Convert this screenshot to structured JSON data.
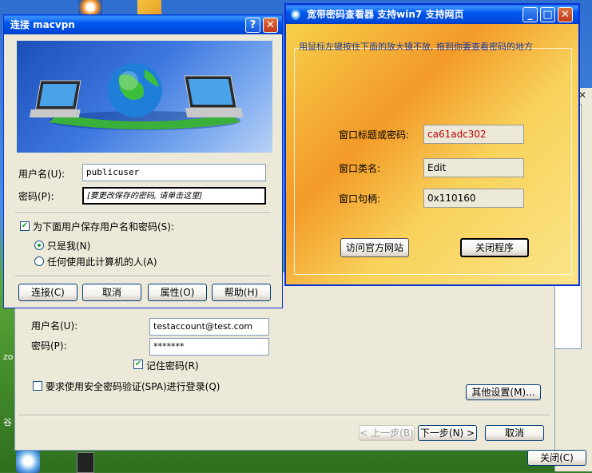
{
  "desktop": {
    "left_text_1": "zo",
    "left_text_2": "谷"
  },
  "bg_window": {
    "username_label": "用户名(U):",
    "username_value": "testaccount@test.com",
    "password_label": "密码(P):",
    "password_value": "*******",
    "remember_label": "记住密码(R)",
    "spa_label": "要求使用安全密码验证(SPA)进行登录(Q)",
    "more_settings": "其他设置(M)...",
    "back_button": "< 上一步(B)",
    "next_button": "下一步(N) >",
    "cancel_button": "取消",
    "close_button": "关闭(C)"
  },
  "connect_dialog": {
    "title": "连接 macvpn",
    "help_glyph": "?",
    "close_glyph": "✕",
    "username_label": "用户名(U):",
    "username_value": "publicuser",
    "password_label": "密码(P):",
    "password_value": "[要更改保存的密码, 请单击这里]",
    "save_checkbox_label": "为下面用户保存用户名和密码(S):",
    "radio_me": "只是我(N)",
    "radio_anyone": "任何使用此计算机的人(A)",
    "buttons": [
      "连接(C)",
      "取消",
      "属性(O)",
      "帮助(H)"
    ]
  },
  "viewer": {
    "title": "宽带密码查看器  支持win7  支持网页",
    "hint": "用鼠标左键按住下面的放大镜不放, 拖到你要查看密码的地方",
    "rows": [
      {
        "label": "窗口标题或密码:",
        "value": "ca61adc302"
      },
      {
        "label": "窗口类名:",
        "value": "Edit"
      },
      {
        "label": "窗口句柄:",
        "value": "0x110160"
      }
    ],
    "visit_button": "访问官方网站",
    "exit_button": "关闭程序",
    "value_color": "#c00000"
  }
}
